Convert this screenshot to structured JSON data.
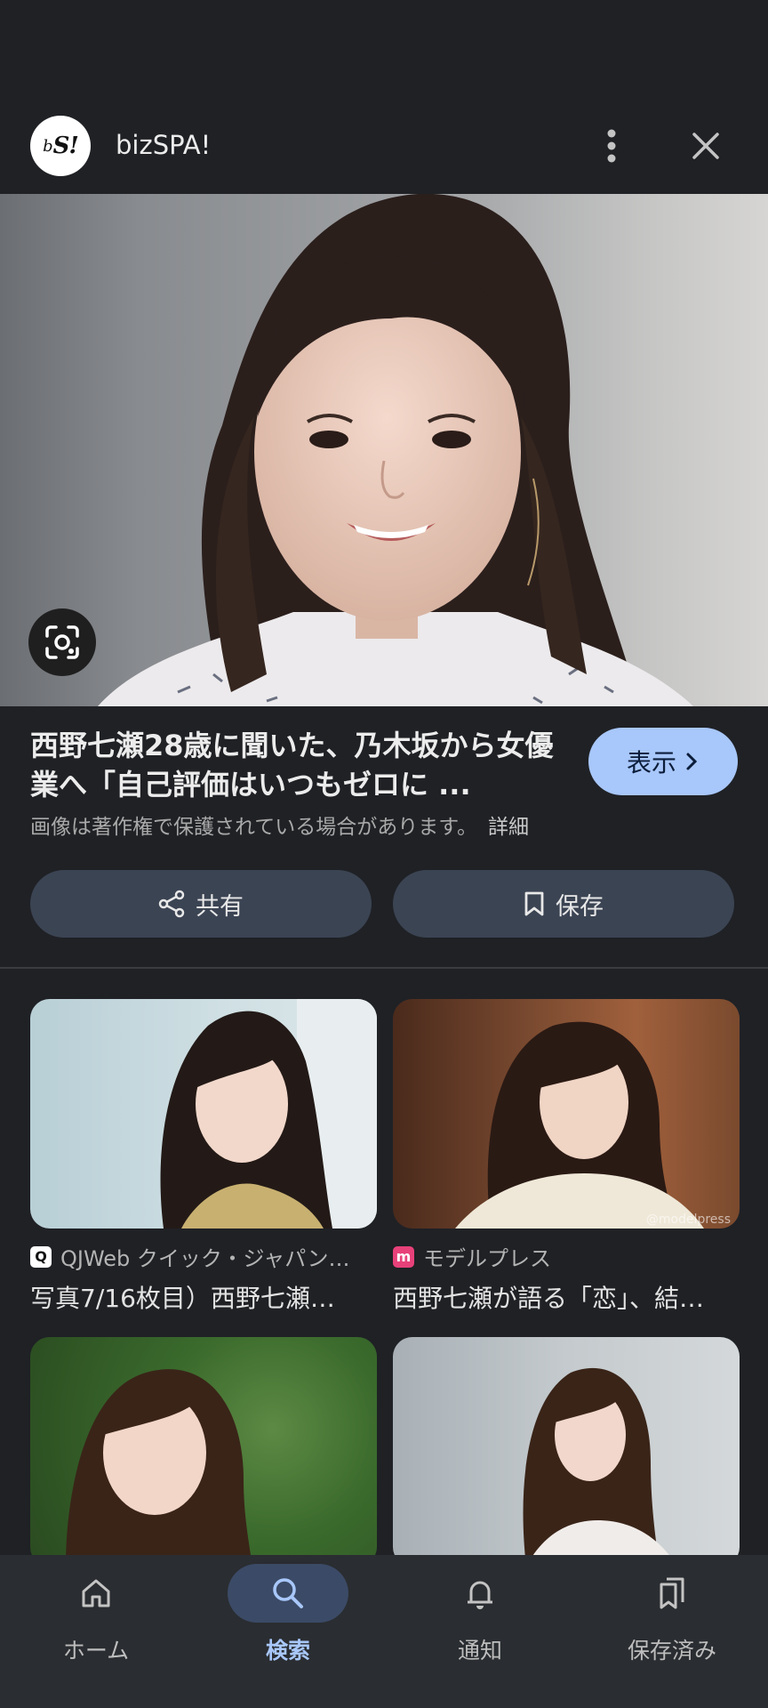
{
  "header": {
    "logo_text": "bS!",
    "site_name": "bizSPA!"
  },
  "result": {
    "title": "西野七瀬28歳に聞いた、乃木坂から女優業へ「自己評価はいつもゼロに ...",
    "copyright_notice": "画像は著作権で保護されている場合があります。",
    "more_link": "詳細",
    "show_button": "表示"
  },
  "actions": {
    "share_label": "共有",
    "save_label": "保存"
  },
  "related": [
    {
      "source": "QJWeb クイック・ジャパン…",
      "caption": "写真7/16枚目）西野七瀬…",
      "source_color": "#ffffff"
    },
    {
      "source": "モデルプレス",
      "caption": "西野七瀬が語る「恋」、結…",
      "source_color": "#e8417a",
      "watermark": "@modelpress"
    },
    {
      "source": "",
      "caption": ""
    },
    {
      "source": "",
      "caption": ""
    }
  ],
  "bottom_nav": {
    "items": [
      {
        "label": "ホーム",
        "icon": "home-icon",
        "active": false
      },
      {
        "label": "検索",
        "icon": "search-icon",
        "active": true
      },
      {
        "label": "通知",
        "icon": "bell-icon",
        "active": false
      },
      {
        "label": "保存済み",
        "icon": "bookmarks-icon",
        "active": false
      }
    ]
  },
  "colors": {
    "background": "#1f2125",
    "accent": "#a8c7fa",
    "button": "#3b4453",
    "active_nav_pill": "#3b4a66"
  }
}
